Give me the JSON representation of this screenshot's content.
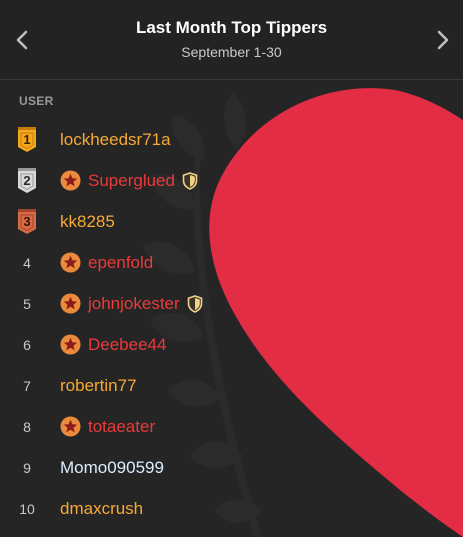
{
  "header": {
    "title": "Last Month Top Tippers",
    "subtitle": "September 1-30"
  },
  "table": {
    "column_header": "USER"
  },
  "rows": [
    {
      "rank": "1",
      "name": "lockheedsr71a",
      "color": "#f7a935",
      "medal": "gold",
      "star_badge": false,
      "shield": false
    },
    {
      "rank": "2",
      "name": "Superglued",
      "color": "#ea3a3a",
      "medal": "silver",
      "star_badge": true,
      "shield": true
    },
    {
      "rank": "3",
      "name": "kk8285",
      "color": "#f7a935",
      "medal": "bronze",
      "star_badge": false,
      "shield": false
    },
    {
      "rank": "4",
      "name": "epenfold",
      "color": "#ea3a3a",
      "medal": null,
      "star_badge": true,
      "shield": false
    },
    {
      "rank": "5",
      "name": "johnjokester",
      "color": "#ea3a3a",
      "medal": null,
      "star_badge": true,
      "shield": true
    },
    {
      "rank": "6",
      "name": "Deebee44",
      "color": "#ea3a3a",
      "medal": null,
      "star_badge": true,
      "shield": false
    },
    {
      "rank": "7",
      "name": "robertin77",
      "color": "#f7a935",
      "medal": null,
      "star_badge": false,
      "shield": false
    },
    {
      "rank": "8",
      "name": "totaeater",
      "color": "#ea3a3a",
      "medal": null,
      "star_badge": true,
      "shield": false
    },
    {
      "rank": "9",
      "name": "Momo090599",
      "color": "#dcecff",
      "medal": null,
      "star_badge": false,
      "shield": false
    },
    {
      "rank": "10",
      "name": "dmaxcrush",
      "color": "#f7a935",
      "medal": null,
      "star_badge": false,
      "shield": false
    }
  ],
  "icons": {
    "prev": "chevron-left-icon",
    "next": "chevron-right-icon",
    "star_badge": "star-badge-icon",
    "shield": "shield-icon",
    "medal": "medal-icon"
  },
  "colors": {
    "background": "#252525",
    "heart": "#e22d44",
    "gold_user": "#f7a935",
    "red_user": "#ea3a3a",
    "new_user": "#dcecff",
    "medal_gold": "#f6a81d",
    "medal_silver": "#d9d9d9",
    "medal_bronze": "#d86a45"
  }
}
